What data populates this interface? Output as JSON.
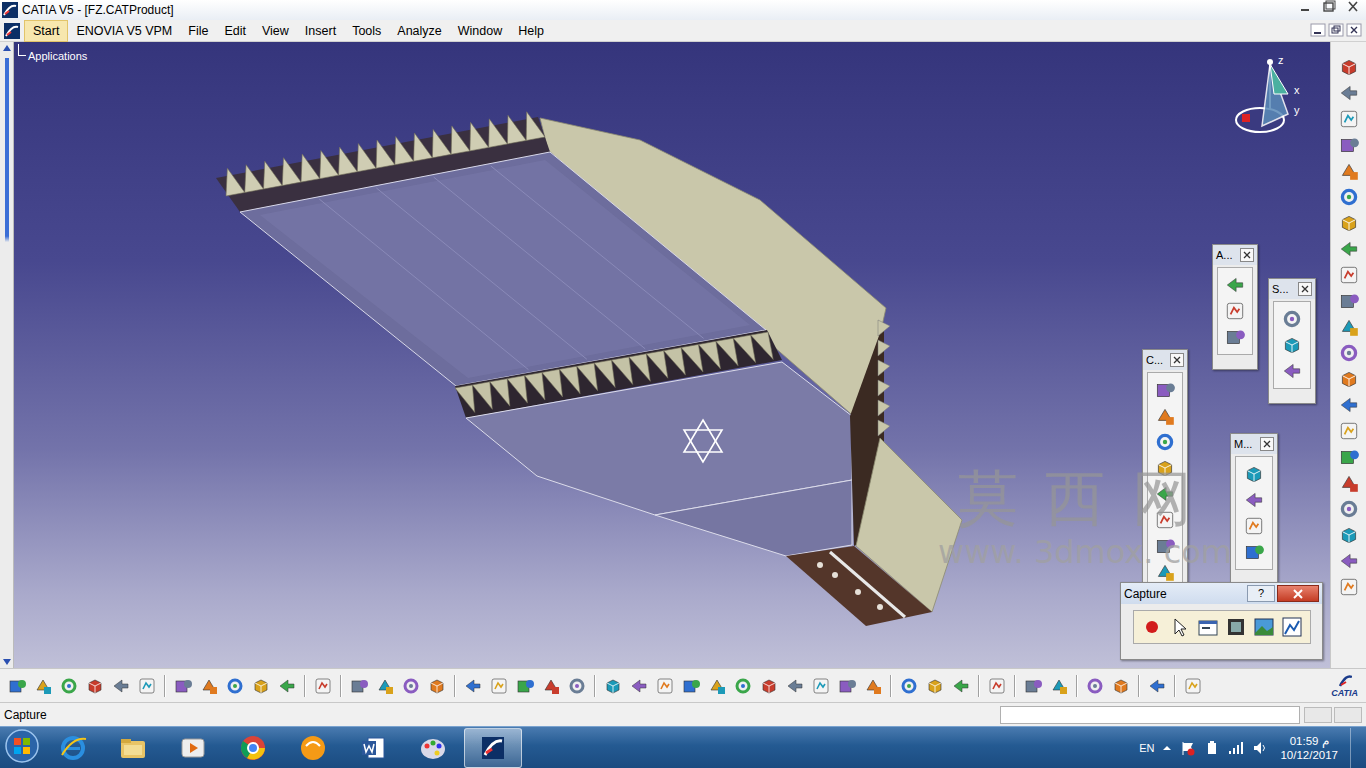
{
  "window": {
    "title": "CATIA V5 - [FZ.CATProduct]"
  },
  "menu": [
    {
      "label": "Start",
      "selected": true
    },
    {
      "label": "ENOVIA V5 VPM",
      "selected": false
    },
    {
      "label": "File",
      "selected": false
    },
    {
      "label": "Edit",
      "selected": false
    },
    {
      "label": "View",
      "selected": false
    },
    {
      "label": "Insert",
      "selected": false
    },
    {
      "label": "Tools",
      "selected": false
    },
    {
      "label": "Analyze",
      "selected": false
    },
    {
      "label": "Window",
      "selected": false
    },
    {
      "label": "Help",
      "selected": false
    }
  ],
  "tree": {
    "root": "Applications"
  },
  "compass": [
    "z",
    "x",
    "y"
  ],
  "toolbars": [
    {
      "title": "A..."
    },
    {
      "title": "S..."
    },
    {
      "title": "C..."
    },
    {
      "title": "M..."
    }
  ],
  "capture": {
    "title": "Capture",
    "help": "?"
  },
  "watermark": {
    "name": "莫 西 网",
    "url": "www. 3dmox. com"
  },
  "logo": "CATIA",
  "status_bar": {
    "text": "Capture"
  },
  "taskbar": {
    "language": "EN",
    "time": "01:59 م",
    "date": "10/12/2017",
    "apps": [
      {
        "selected": false
      },
      {
        "selected": false
      },
      {
        "selected": false
      },
      {
        "selected": false
      },
      {
        "selected": false
      },
      {
        "selected": false
      },
      {
        "selected": false
      },
      {
        "selected": true
      }
    ]
  }
}
